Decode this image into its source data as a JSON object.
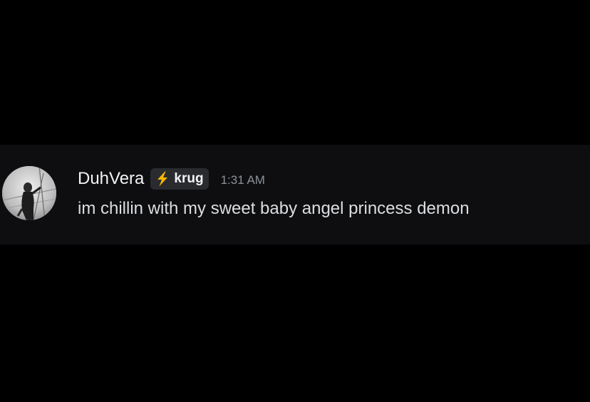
{
  "message": {
    "author": "DuhVera",
    "tag": {
      "icon": "lightning-bolt-icon",
      "icon_color": "#f5b800",
      "label": "krug"
    },
    "timestamp": "1:31 AM",
    "content": "im chillin with my sweet baby angel princess demon"
  },
  "colors": {
    "background": "#000000",
    "message_background": "#0e0e10",
    "username": "#f2f3f5",
    "tag_background": "#2a2b2f",
    "timestamp": "#8e9297",
    "content": "#dbdee1"
  }
}
